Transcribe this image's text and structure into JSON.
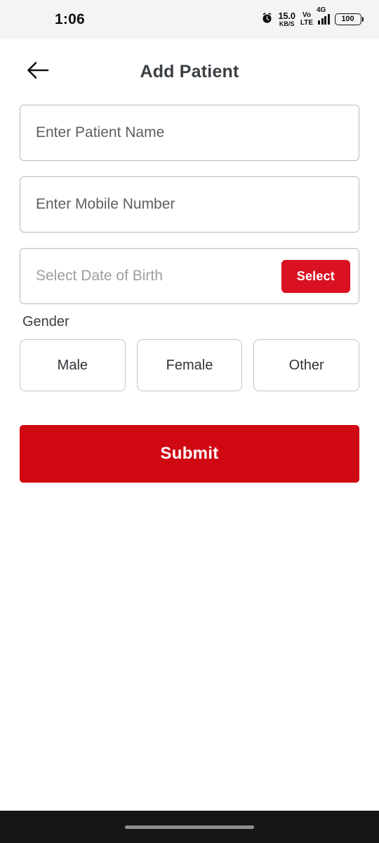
{
  "status_bar": {
    "time": "1:06",
    "alarm_icon": "alarm-clock-icon",
    "network_speed_value": "15.0",
    "network_speed_unit": "KB/S",
    "volte_line1": "Vo",
    "volte_line2": "LTE",
    "network_type": "4G",
    "signal_icon": "signal-bars-icon",
    "battery_level": "100"
  },
  "header": {
    "back_icon": "back-arrow-icon",
    "title": "Add Patient"
  },
  "form": {
    "patient_name": {
      "placeholder": "Enter Patient Name",
      "value": ""
    },
    "mobile_number": {
      "placeholder": "Enter Mobile Number",
      "value": ""
    },
    "date_of_birth": {
      "placeholder": "Select Date of Birth",
      "value": "",
      "select_label": "Select"
    },
    "gender": {
      "label": "Gender",
      "options": [
        {
          "label": "Male"
        },
        {
          "label": "Female"
        },
        {
          "label": "Other"
        }
      ],
      "selected": ""
    },
    "submit_label": "Submit"
  },
  "colors": {
    "accent_red": "#da1122",
    "submit_red": "#cf0812",
    "title_gray": "#3a3f44",
    "border_gray": "#b9b9b9",
    "status_bg": "#f4f4f4",
    "nav_bg": "#161616"
  }
}
